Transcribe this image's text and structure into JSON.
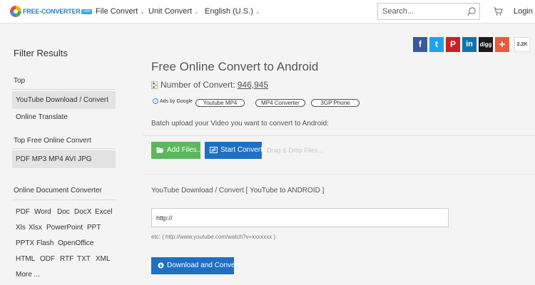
{
  "navbar": {
    "logo_text": "FREE-CONVERTER",
    "logo_suffix": ".com",
    "menu": [
      {
        "label": "File Convert",
        "caret": "⌄"
      },
      {
        "label": "Unit Convert",
        "caret": "⌄"
      },
      {
        "label": "English (U.S.)",
        "caret": "⌄"
      }
    ],
    "search_placeholder": "Search...",
    "search_icon": "search-icon",
    "cart_icon": "cart-icon",
    "login_label": "Login"
  },
  "social": {
    "buttons": [
      {
        "name": "facebook",
        "glyph": "f",
        "color": "#3b5998"
      },
      {
        "name": "twitter",
        "glyph": "t",
        "color": "#1da1f2"
      },
      {
        "name": "pinterest",
        "glyph": "P",
        "color": "#cb2027"
      },
      {
        "name": "linkedin",
        "glyph": "in",
        "color": "#0e76a8"
      },
      {
        "name": "digg",
        "glyph": "digg",
        "color": "#1a1a1a"
      },
      {
        "name": "more",
        "glyph": "+",
        "color": "#eb5a3e"
      }
    ],
    "share_count": "2.2K"
  },
  "sidebar": {
    "title": "Filter Results",
    "top_heading": "Top",
    "top_items": [
      "YouTube Download / Convert",
      "Online Translate"
    ],
    "free_heading": "Top Free Online Convert",
    "free_item": "PDF MP3 MP4 AVI JPG",
    "doc_heading": "Online Document Converter",
    "doc_rows": [
      [
        "PDF",
        "Word",
        "Doc",
        "DocX",
        "Excel"
      ],
      [
        "Xls",
        "Xlsx",
        "PowerPoint",
        "PPT"
      ],
      [
        "PPTX",
        "Flash",
        "OpenOffice"
      ],
      [
        "HTML",
        "ODF",
        "RTF",
        "TXT",
        "XML"
      ],
      [
        "More ..."
      ]
    ]
  },
  "main": {
    "title": "Free Online Convert to Android",
    "count_label": "Number of Convert:",
    "count_value": "946,945",
    "ads_label": "Ads by Google",
    "ad_pills": [
      "Youtube MP4",
      "MP4 Converter",
      "3GP Phone"
    ],
    "batch_text": "Batch upload your Video you want to convert to Android:",
    "add_files_label": "Add Files...",
    "start_convert_label": "Start Convert",
    "drag_drop_label": "Drag & Drop Files...",
    "youtube_title": "YouTube Download / Convert [ YouTube to ANDROID ]",
    "url_value": "http://",
    "url_example": "etc: ( http://www.youtube.com/watch?v=xxxxxxx )",
    "download_label": "Download and Convert"
  },
  "colors": {
    "green_button": "#5cb85c",
    "blue_button": "#1f6fc4",
    "active_sidebar": "#e3e3e3",
    "background": "#f4f4f4"
  }
}
